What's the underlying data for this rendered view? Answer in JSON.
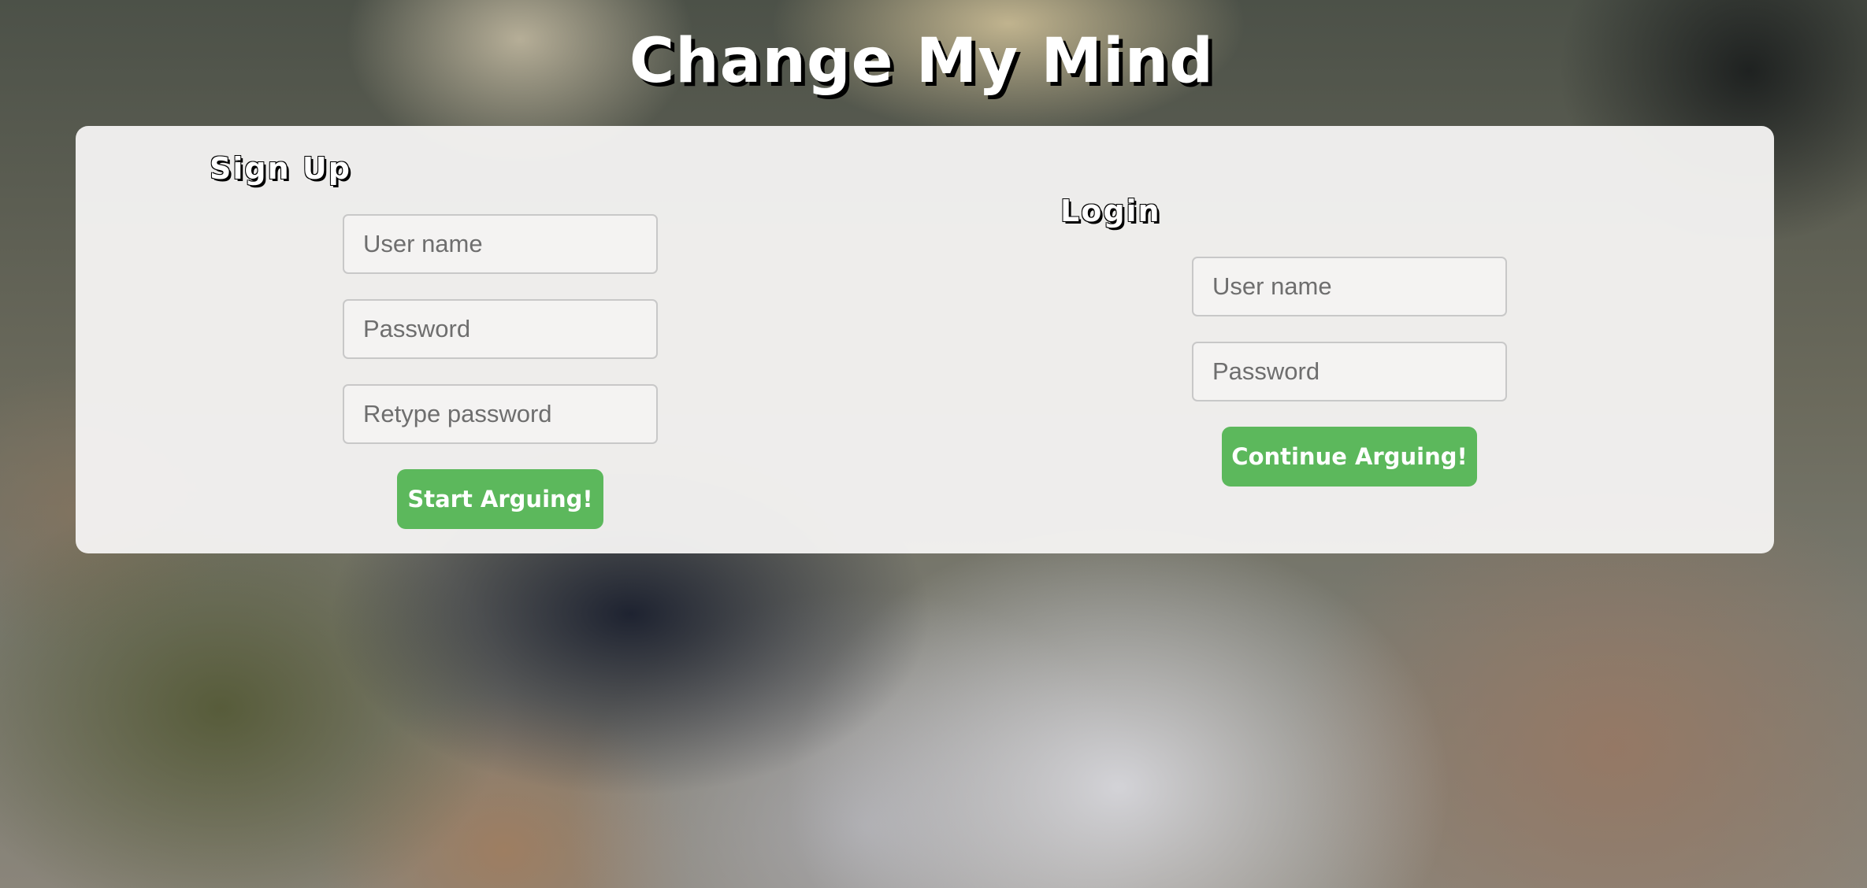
{
  "page": {
    "title": "Change My Mind"
  },
  "signup": {
    "heading": "Sign Up",
    "username_placeholder": "User name",
    "password_placeholder": "Password",
    "retype_placeholder": "Retype password",
    "submit_label": "Start Arguing!"
  },
  "login": {
    "heading": "Login",
    "username_placeholder": "User name",
    "password_placeholder": "Password",
    "submit_label": "Continue Arguing!"
  },
  "colors": {
    "accent": "#5cb85c",
    "card_background": "#f4f3f1",
    "title_text": "#ffffff",
    "title_shadow": "#000000"
  }
}
